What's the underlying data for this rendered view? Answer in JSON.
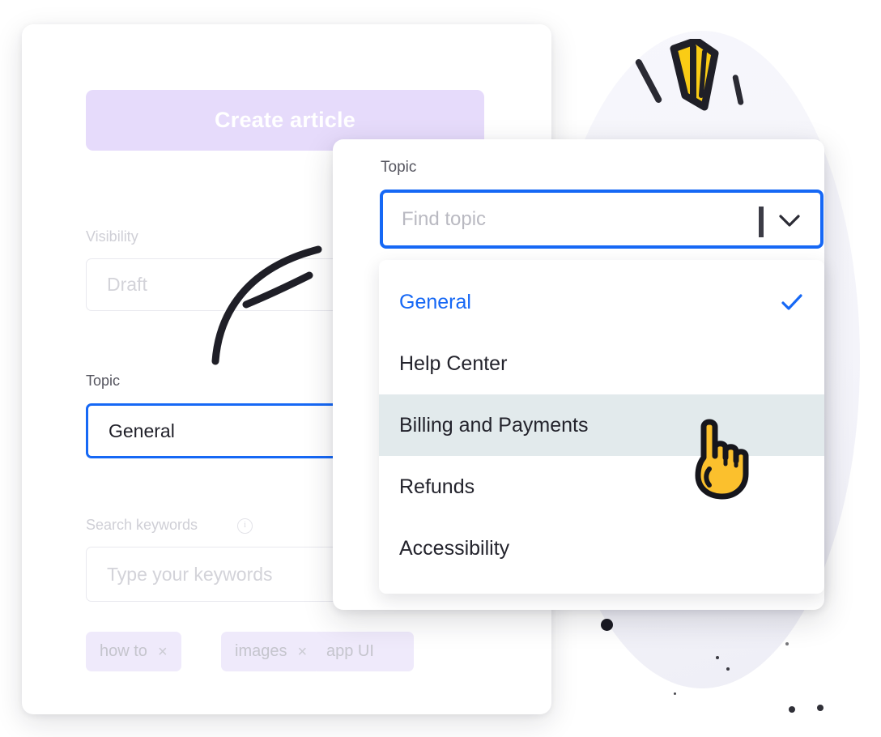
{
  "form": {
    "create_button_label": "Create article",
    "visibility": {
      "label": "Visibility",
      "value": "Draft"
    },
    "topic": {
      "label": "Topic",
      "value": "General"
    },
    "search_keywords": {
      "label": "Search keywords",
      "info_glyph": "i",
      "placeholder": "Type your keywords"
    },
    "tags": [
      {
        "label": "how to",
        "remove_glyph": "×"
      },
      {
        "label": "images",
        "remove_glyph": "×"
      },
      {
        "label": "app UI",
        "remove_glyph": ""
      }
    ]
  },
  "dropdown": {
    "label": "Topic",
    "search_placeholder": "Find topic",
    "options": [
      {
        "label": "General",
        "selected": true,
        "hovered": false,
        "check_glyph": "✓"
      },
      {
        "label": "Help Center",
        "selected": false,
        "hovered": false,
        "check_glyph": ""
      },
      {
        "label": "Billing and Payments",
        "selected": false,
        "hovered": true,
        "check_glyph": ""
      },
      {
        "label": "Refunds",
        "selected": false,
        "hovered": false,
        "check_glyph": ""
      },
      {
        "label": "Accessibility",
        "selected": false,
        "hovered": false,
        "check_glyph": ""
      }
    ]
  },
  "colors": {
    "accent_blue": "#1668f5",
    "button_lavender": "#e6dbfb",
    "tag_lavender": "#efeafb",
    "hover_row": "#e2eaec",
    "sparkle_yellow": "#facc15",
    "ink": "#23232c",
    "muted": "#cfcfd6"
  }
}
